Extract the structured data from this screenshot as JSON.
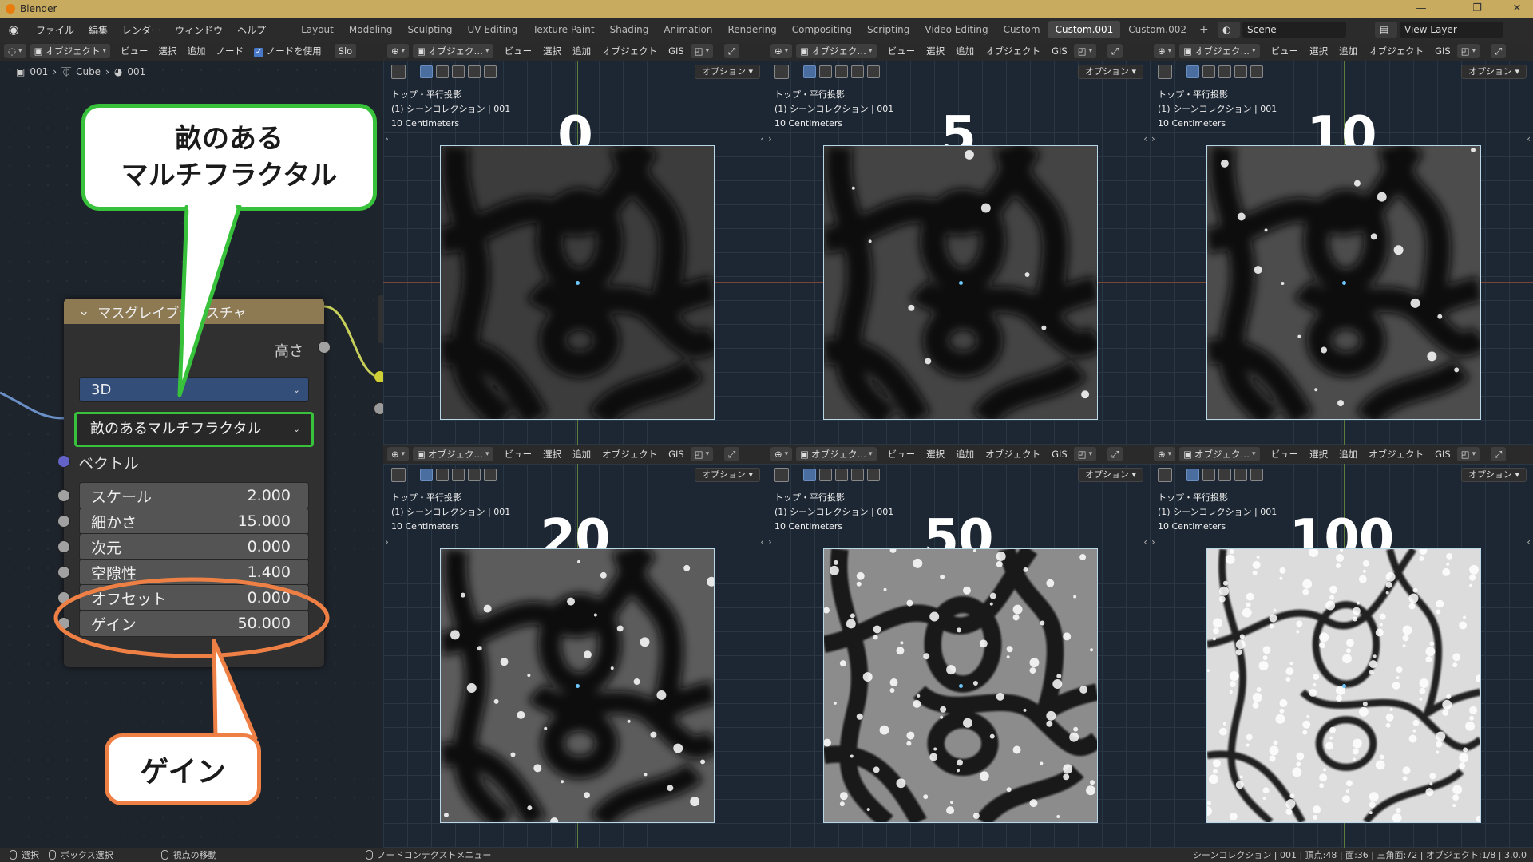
{
  "window": {
    "title": "Blender"
  },
  "menu": [
    "ファイル",
    "編集",
    "レンダー",
    "ウィンドウ",
    "ヘルプ"
  ],
  "workspaces": [
    "Layout",
    "Modeling",
    "Sculpting",
    "UV Editing",
    "Texture Paint",
    "Shading",
    "Animation",
    "Rendering",
    "Compositing",
    "Scripting",
    "Video Editing",
    "Custom",
    "Custom.001",
    "Custom.002"
  ],
  "active_workspace": "Custom.001",
  "add_workspace": "+",
  "scene": {
    "name": "Scene",
    "view_layer": "View Layer"
  },
  "node_editor": {
    "mode": "オブジェクト",
    "menus": [
      "ビュー",
      "選択",
      "追加",
      "ノード"
    ],
    "use_nodes": "ノードを使用",
    "slot": "Slo",
    "breadcrumb": [
      "001",
      "Cube",
      "001"
    ],
    "node": {
      "title": "マスグレイブテクスチャ",
      "output": "高さ",
      "dimensions": "3D",
      "type": "畝のあるマルチフラクタル",
      "vector": "ベクトル",
      "params": [
        {
          "label": "スケール",
          "value": "2.000"
        },
        {
          "label": "細かさ",
          "value": "15.000"
        },
        {
          "label": "次元",
          "value": "0.000"
        },
        {
          "label": "空隙性",
          "value": "1.400"
        },
        {
          "label": "オフセット",
          "value": "0.000"
        },
        {
          "label": "ゲイン",
          "value": "50.000"
        }
      ]
    }
  },
  "viewport_header": {
    "mode": "オブジェク…",
    "menus": [
      "ビュー",
      "選択",
      "追加",
      "オブジェクト",
      "GIS"
    ],
    "options": "オプション"
  },
  "viewports": [
    {
      "label": "0",
      "view": "トップ・平行投影",
      "collection": "(1) シーンコレクション | 001",
      "scale": "10 Centimeters"
    },
    {
      "label": "5",
      "view": "トップ・平行投影",
      "collection": "(1) シーンコレクション | 001",
      "scale": "10 Centimeters"
    },
    {
      "label": "10",
      "view": "トップ・平行投影",
      "collection": "(1) シーンコレクション | 001",
      "scale": "10 Centimeters"
    },
    {
      "label": "20",
      "view": "トップ・平行投影",
      "collection": "(1) シーンコレクション | 001",
      "scale": "10 Centimeters"
    },
    {
      "label": "50",
      "view": "トップ・平行投影",
      "collection": "(1) シーンコレクション | 001",
      "scale": "10 Centimeters"
    },
    {
      "label": "100",
      "view": "トップ・平行投影",
      "collection": "(1) シーンコレクション | 001",
      "scale": "10 Centimeters"
    }
  ],
  "callouts": {
    "type": "畝のある\nマルチフラクタル",
    "gain": "ゲイン"
  },
  "colors": {
    "type_callout": "#38c23b",
    "gain_callout": "#ef8045",
    "node_header": "#8d7a52"
  },
  "status": {
    "select": "選択",
    "box_select": "ボックス選択",
    "pan": "視点の移動",
    "context": "ノードコンテクストメニュー",
    "stats": "シーンコレクション | 001 | 頂点:48 | 面:36 | 三角面:72 | オブジェクト:1/8 | 3.0.0"
  }
}
